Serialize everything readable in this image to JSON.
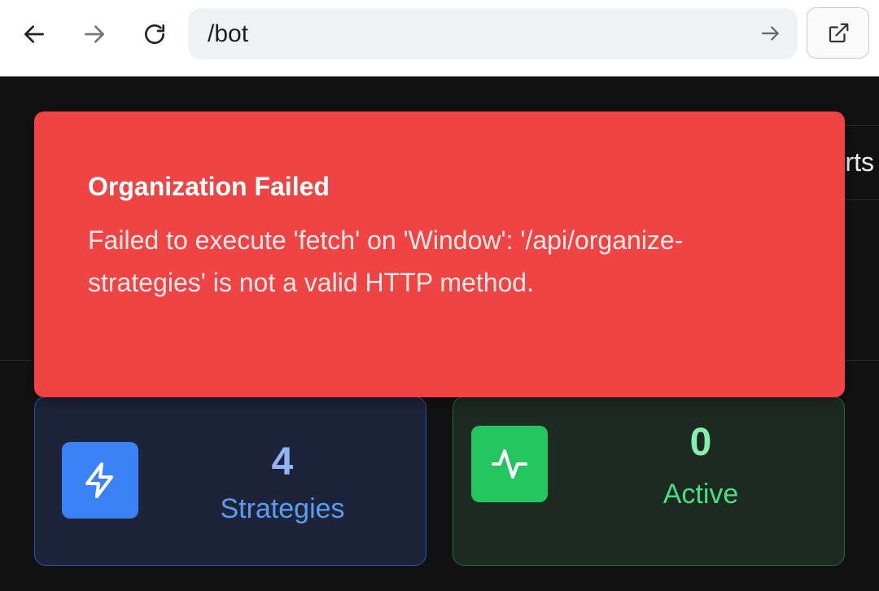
{
  "browser": {
    "url": "/bot",
    "icons": {
      "back": "arrow-left-icon",
      "forward": "arrow-right-icon",
      "reload": "reload-icon",
      "go": "arrow-right-icon",
      "external": "external-link-icon"
    }
  },
  "page": {
    "tab_partial_label": "rts"
  },
  "toast": {
    "title": "Organization Failed",
    "description": "Failed to execute 'fetch' on 'Window': '/api/organize-strategies' is not a valid HTTP method.",
    "color": "#ef4444"
  },
  "stats": [
    {
      "value": "4",
      "label": "Strategies",
      "icon": "lightning-icon",
      "color": "#3b82f6"
    },
    {
      "value": "0",
      "label": "Active",
      "icon": "activity-icon",
      "color": "#22c55e"
    }
  ]
}
